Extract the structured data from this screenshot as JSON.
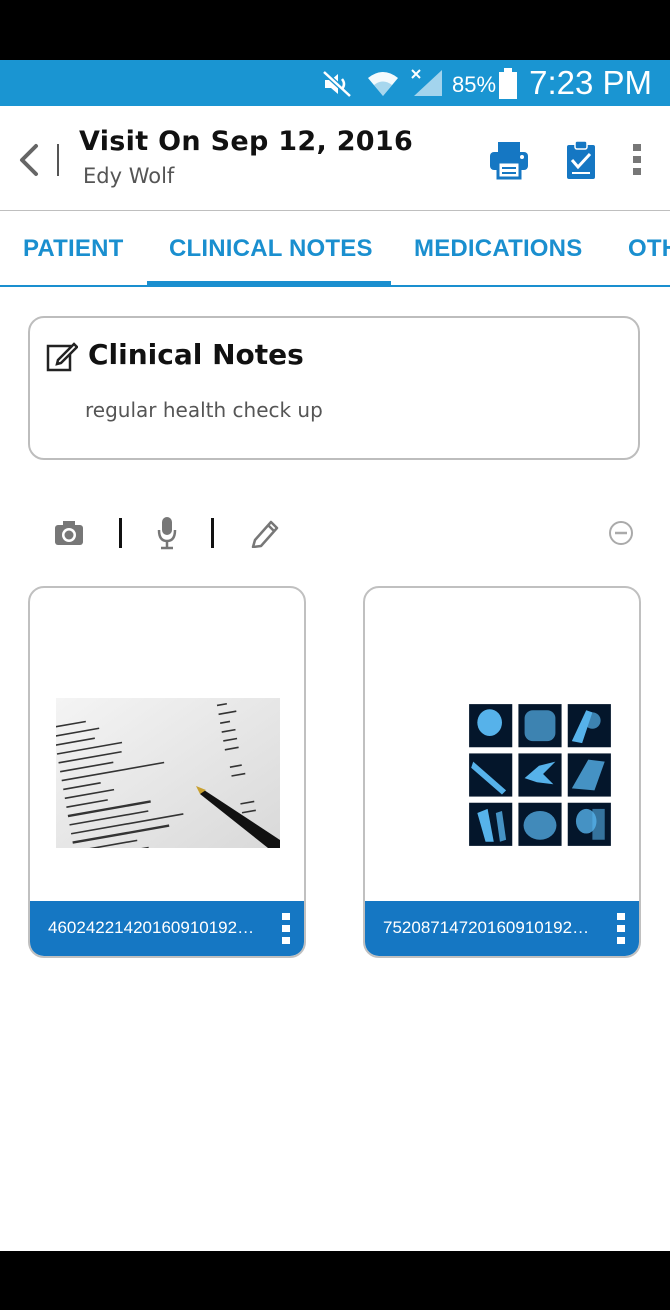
{
  "status_bar": {
    "battery_percent": "85%",
    "time": "7:23 PM",
    "color": "#1a95d2",
    "icons": [
      "mute-icon",
      "wifi-icon",
      "signal-icon",
      "battery-icon"
    ]
  },
  "header": {
    "title": "Visit On Sep 12, 2016",
    "subtitle": "Edy Wolf",
    "icons": [
      "back-arrow-icon",
      "print-icon",
      "clipboard-check-icon",
      "more-vert-icon"
    ]
  },
  "tabs": [
    {
      "label": "PATIENT",
      "active": false
    },
    {
      "label": "CLINICAL NOTES",
      "active": true
    },
    {
      "label": "MEDICATIONS",
      "active": false
    },
    {
      "label": "OTHER",
      "active": false
    }
  ],
  "notes_card": {
    "title": "Clinical Notes",
    "text": "regular health check up",
    "icon": "edit-note-icon"
  },
  "toolbar": {
    "icons": [
      "camera-icon",
      "microphone-icon",
      "pencil-icon",
      "remove-circle-icon"
    ]
  },
  "attachments": [
    {
      "filename": "46024221420160910192…",
      "thumbnail": "lab-report-image"
    },
    {
      "filename": "75208714720160910192…",
      "thumbnail": "xray-collage-image"
    }
  ],
  "colors": {
    "accent": "#1a8fcf",
    "attachment_footer": "#1577c3"
  }
}
